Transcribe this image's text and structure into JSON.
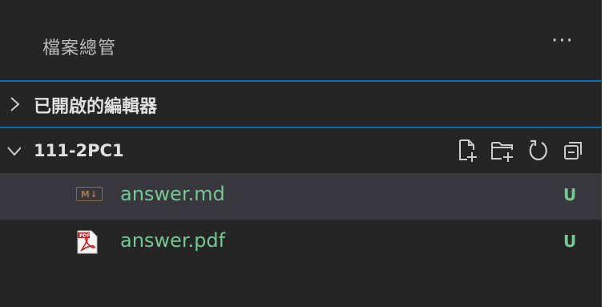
{
  "explorer": {
    "title": "檔案總管",
    "more_actions": "···"
  },
  "open_editors": {
    "label": "已開啟的編輯器"
  },
  "folder": {
    "label": "111-2PC1",
    "actions": [
      "new-file-icon",
      "new-folder-icon",
      "refresh-icon",
      "collapse-all-icon"
    ]
  },
  "files": [
    {
      "name": "answer.md",
      "status": "U",
      "icon": "markdown-icon",
      "badge": "M↓"
    },
    {
      "name": "answer.pdf",
      "status": "U",
      "icon": "pdf-icon"
    }
  ],
  "colors": {
    "background": "#252526",
    "selected_row": "#37373d",
    "untracked": "#73c991",
    "focus_border": "#0a6fb2"
  }
}
